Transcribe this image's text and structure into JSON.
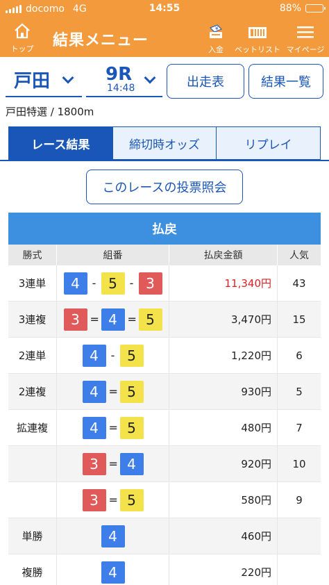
{
  "status": {
    "carrier": "docomo",
    "network": "4G",
    "time": "14:55",
    "battery": "88%",
    "battery_level": 0.88
  },
  "header": {
    "home_label": "トップ",
    "title": "結果メニュー",
    "deposit_label": "入金",
    "betlist_label": "ベットリスト",
    "mypage_label": "マイページ",
    "deposit_badge": "¥"
  },
  "venue": {
    "name": "戸田",
    "race": "9R",
    "race_time": "14:48"
  },
  "buttons": {
    "entries": "出走表",
    "results_list": "結果一覧",
    "ticket_inquiry": "このレースの投票照会"
  },
  "race_info": "戸田特選 / 1800m",
  "tabs": [
    "レース結果",
    "締切時オッズ",
    "リプレイ"
  ],
  "payout": {
    "title": "払戻",
    "columns": [
      "勝式",
      "組番",
      "払戻金額",
      "人気"
    ],
    "rows": [
      {
        "type": "3連単",
        "combo": [
          "4",
          "-",
          "5",
          "-",
          "3"
        ],
        "amount": "11,340円",
        "pop": "43"
      },
      {
        "type": "3連複",
        "combo": [
          "3",
          "=",
          "4",
          "=",
          "5"
        ],
        "amount": "3,470円",
        "pop": "15"
      },
      {
        "type": "2連単",
        "combo": [
          "4",
          "-",
          "5"
        ],
        "amount": "1,220円",
        "pop": "6"
      },
      {
        "type": "2連複",
        "combo": [
          "4",
          "=",
          "5"
        ],
        "amount": "930円",
        "pop": "5"
      },
      {
        "type": "拡連複",
        "combo": [
          "4",
          "=",
          "5"
        ],
        "amount": "480円",
        "pop": "7"
      },
      {
        "type": "",
        "combo": [
          "3",
          "=",
          "4"
        ],
        "amount": "920円",
        "pop": "10"
      },
      {
        "type": "",
        "combo": [
          "3",
          "=",
          "5"
        ],
        "amount": "580円",
        "pop": "9"
      },
      {
        "type": "単勝",
        "combo": [
          "4"
        ],
        "amount": "460円",
        "pop": ""
      },
      {
        "type": "複勝",
        "combo": [
          "4"
        ],
        "amount": "220円",
        "pop": ""
      }
    ]
  },
  "colors": {
    "accent": "#f29a3c",
    "primary": "#1a56b8",
    "highlight_amount": "#e02020"
  }
}
